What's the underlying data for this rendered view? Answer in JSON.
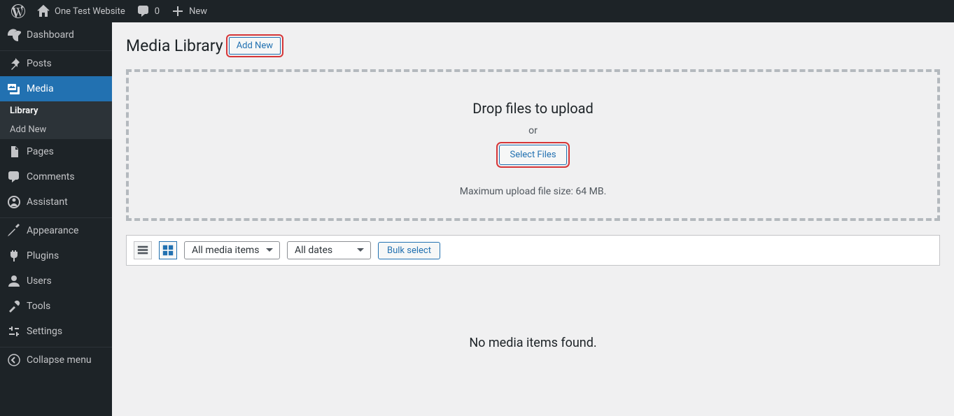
{
  "topbar": {
    "site_name": "One Test Website",
    "comment_count": "0",
    "new_label": "New"
  },
  "sidebar": {
    "dashboard": "Dashboard",
    "posts": "Posts",
    "media": "Media",
    "media_sub": {
      "library": "Library",
      "add_new": "Add New"
    },
    "pages": "Pages",
    "comments": "Comments",
    "assistant": "Assistant",
    "appearance": "Appearance",
    "plugins": "Plugins",
    "users": "Users",
    "tools": "Tools",
    "settings": "Settings",
    "collapse": "Collapse menu"
  },
  "page": {
    "title": "Media Library",
    "add_new": "Add New"
  },
  "dropzone": {
    "heading": "Drop files to upload",
    "or": "or",
    "select_files": "Select Files",
    "max_size": "Maximum upload file size: 64 MB."
  },
  "filters": {
    "media_type": "All media items",
    "date": "All dates",
    "bulk_select": "Bulk select"
  },
  "empty_state": "No media items found."
}
